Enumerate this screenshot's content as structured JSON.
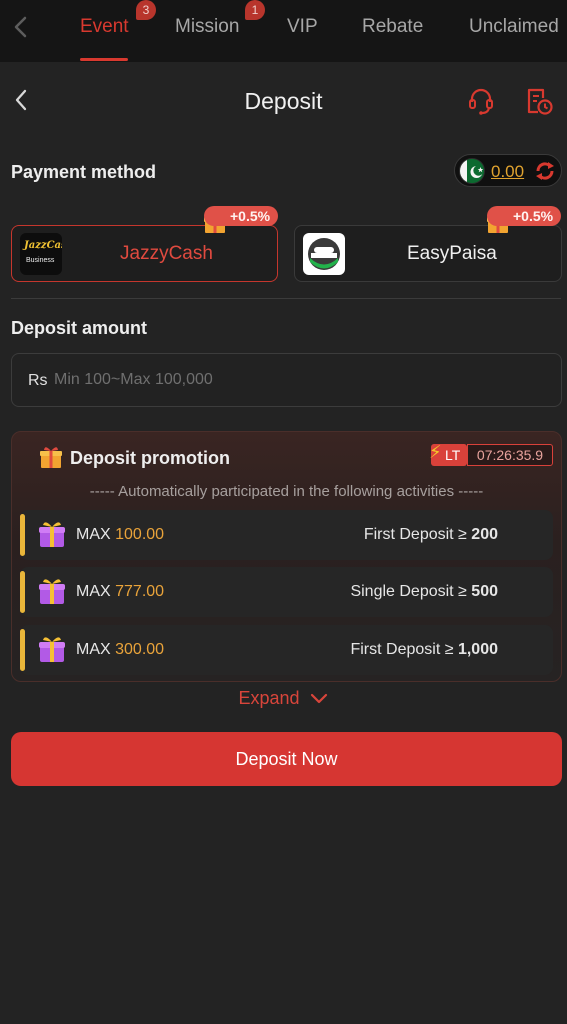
{
  "tabs": [
    {
      "label": "Event",
      "badge": "3",
      "active": true
    },
    {
      "label": "Mission",
      "badge": "1",
      "active": false
    },
    {
      "label": "VIP",
      "badge": "",
      "active": false
    },
    {
      "label": "Rebate",
      "badge": "",
      "active": false
    },
    {
      "label": "Unclaimed",
      "badge": "",
      "active": false
    }
  ],
  "header": {
    "title": "Deposit"
  },
  "payment": {
    "label": "Payment method",
    "balance": "0.00",
    "methods": [
      {
        "name": "JazzyCash",
        "logo_text": "JazzCash",
        "logo_sub": "Business",
        "bonus": "+0.5%",
        "selected": true
      },
      {
        "name": "EasyPaisa",
        "bonus": "+0.5%",
        "selected": false
      }
    ]
  },
  "amount": {
    "label": "Deposit amount",
    "currency": "Rs",
    "placeholder": "Min 100~Max 100,000"
  },
  "promotion": {
    "title": "Deposit promotion",
    "lt": "LT",
    "timer": "07:26:35.9",
    "subtitle": "----- Automatically participated in the following activities -----",
    "rows": [
      {
        "max_label": "MAX",
        "max_value": "100.00",
        "condition": "First Deposit ≥",
        "threshold": "200"
      },
      {
        "max_label": "MAX",
        "max_value": "777.00",
        "condition": "Single Deposit ≥",
        "threshold": "500"
      },
      {
        "max_label": "MAX",
        "max_value": "300.00",
        "condition": "First Deposit ≥",
        "threshold": "1,000"
      }
    ],
    "expand": "Expand"
  },
  "deposit_button": "Deposit Now",
  "colors": {
    "accent": "#d63632",
    "gold": "#e9a33a",
    "background": "#232323"
  }
}
